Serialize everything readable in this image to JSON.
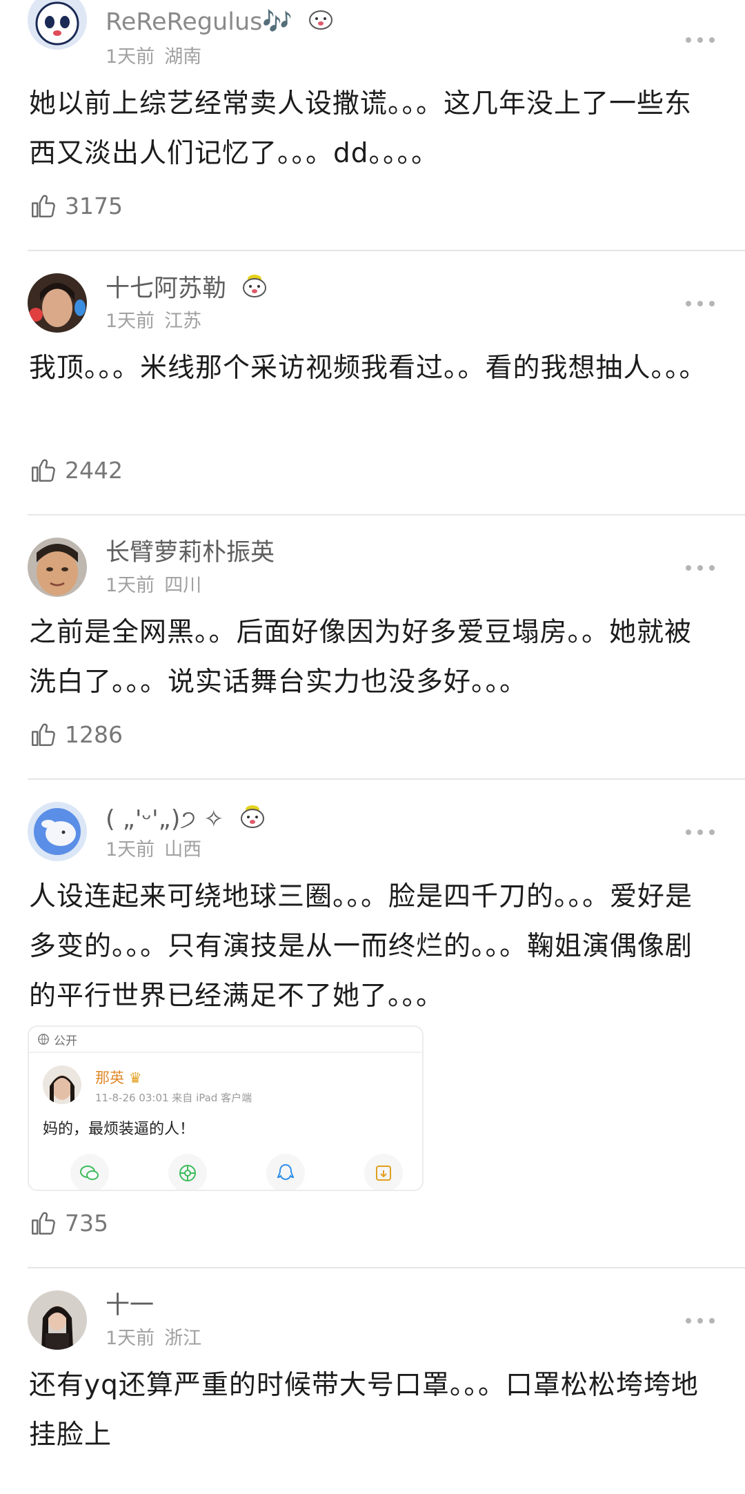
{
  "comments": [
    {
      "username": "ReReRegulus🎶",
      "time": "1天前",
      "location": "湖南",
      "text": "她以前上综艺经常卖人设撒谎。。。这几年没上了一些东西又淡出人们记忆了。。。dd。。。。",
      "likes": "3175"
    },
    {
      "username": "十七阿苏勒",
      "time": "1天前",
      "location": "江苏",
      "text": "我顶。。。米线那个采访视频我看过。。看的我想抽人。。。",
      "likes": "2442"
    },
    {
      "username": "长臂萝莉朴振英",
      "time": "1天前",
      "location": "四川",
      "text": "之前是全网黑。。后面好像因为好多爱豆塌房。。她就被洗白了。。。说实话舞台实力也没多好。。。",
      "likes": "1286"
    },
    {
      "username": "( „'ᵕ'„)੭ ✧",
      "time": "1天前",
      "location": "山西",
      "text": "人设连起来可绕地球三圈。。。脸是四千刀的。。。爱好是多变的。。。只有演技是从一而终烂的。。。鞠姐演偶像剧的平行世界已经满足不了她了。。。",
      "likes": "735",
      "embed": {
        "visibility": "公开",
        "poster_name": "那英",
        "poster_meta": "11-8-26 03:01 来自 iPad 客户端",
        "post_text": "妈的，最烦装逼的人！"
      }
    },
    {
      "username": "十一",
      "time": "1天前",
      "location": "浙江",
      "text": "还有yq还算严重的时候带大号口罩。。。口罩松松垮垮地挂脸上"
    }
  ],
  "icons": {
    "like": "thumbs-up-icon",
    "more": "more-dots-icon",
    "badge": "tiger-face-badge-icon",
    "globe": "globe-icon"
  },
  "colors": {
    "username": "#5f5f5f",
    "meta": "#a0a0a0",
    "text": "#1c1c1c",
    "divider": "#e6e6e6",
    "embed_poster": "#e08a2a"
  }
}
